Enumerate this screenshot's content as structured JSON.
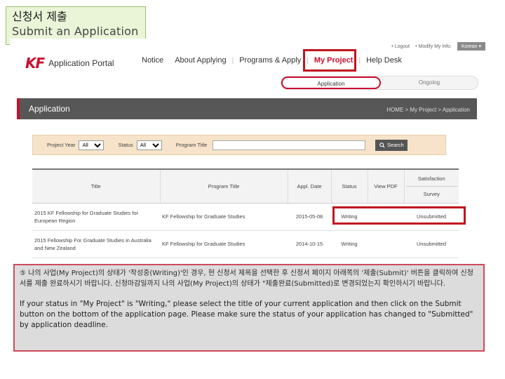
{
  "header": {
    "title_ko": "신청서 제출",
    "title_en": "Submit an Application"
  },
  "utility": {
    "logout": "• Logout",
    "modify": "• Modify My Info.",
    "language": "Korean ▾"
  },
  "portal": {
    "logo_mark": "KF",
    "name": "Application Portal"
  },
  "nav": {
    "items": [
      "Notice",
      "About Applying",
      "Programs & Apply",
      "My Project",
      "Help Desk"
    ],
    "active": "My Project"
  },
  "subtabs": [
    "Application",
    "Ongoing"
  ],
  "page": {
    "title": "Application",
    "breadcrumb": "HOME > My Project > Application"
  },
  "search": {
    "project_year_label": "Project Year",
    "project_year_value": "All",
    "status_label": "Status",
    "status_value": "All",
    "program_title_label": "Program Title",
    "button": "Search"
  },
  "table": {
    "headers": {
      "title": "Title",
      "program_title": "Program Title",
      "appl_date": "Appl. Date",
      "status": "Status",
      "view_pdf": "View PDF",
      "satisfaction": "Satisfaction",
      "survey": "Survey"
    },
    "rows": [
      {
        "title": "2015 KF Fellowship for Graduate Studies for European Region",
        "program": "KF Fellowship for Graduate Studies",
        "date": "2015-05-08",
        "status": "Writing",
        "survey": "Unsubmitted"
      },
      {
        "title": "2015 Fellowship For Graduate Studies in Australia and New Zealand",
        "program": "KF Fellowship for Graduate Studies",
        "date": "2014-10-15",
        "status": "Writing",
        "survey": "Unsubmitted"
      }
    ]
  },
  "note": {
    "ko": "⑤ 나의 사업(My Project)의 상태가 '작성중(Writing)'인 경우, 현 신청서 제목을 선택한 후 신청서 페이지 아래쪽의 '제출(Submit)' 버튼을 클릭하여 신청서를 제출 완료하시기 바랍니다. 신청마감일까지 나의 사업(My Project)의 상태가 \"제출완료(Submitted)로 변경되었는지 확인하시기 바랍니다.",
    "en": "If your status in \"My Project\" is \"Writing,\" please select the title of your current application and then click on the Submit button on the bottom of the application page. Please make sure the status of your application has changed to \"Submitted\" by application deadline."
  },
  "colors": {
    "brand": "#c8102e",
    "highlight": "#c0161e",
    "search_bg": "#f6e3c9",
    "note_bg": "#dcdcdc"
  }
}
